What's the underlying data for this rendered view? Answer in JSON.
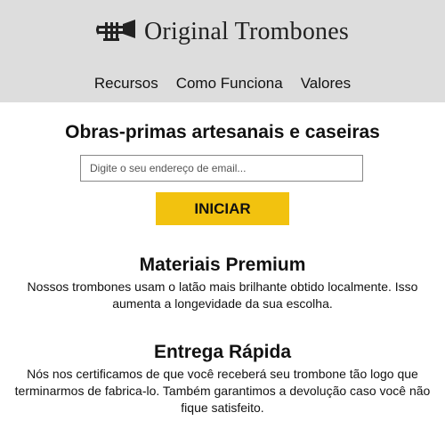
{
  "brand": {
    "name": "Original Trombones",
    "logo_icon": "trombone-icon"
  },
  "nav": {
    "items": [
      "Recursos",
      "Como Funciona",
      "Valores"
    ]
  },
  "hero": {
    "title": "Obras-primas artesanais e caseiras",
    "email_placeholder": "Digite o seu endereço de email...",
    "button_label": "INICIAR",
    "button_color": "#f2c20f"
  },
  "features": [
    {
      "title": "Materiais Premium",
      "description": "Nossos trombones usam o latão mais brilhante obtido localmente. Isso aumenta a longevidade da sua escolha."
    },
    {
      "title": "Entrega Rápida",
      "description": "Nós nos certificamos de que você receberá seu trombone tão logo que terminarmos de fabrica-lo. Também garantimos a devolução caso você não fique satisfeito."
    }
  ],
  "colors": {
    "header_background": "#dddddd",
    "accent": "#f2c20f"
  }
}
